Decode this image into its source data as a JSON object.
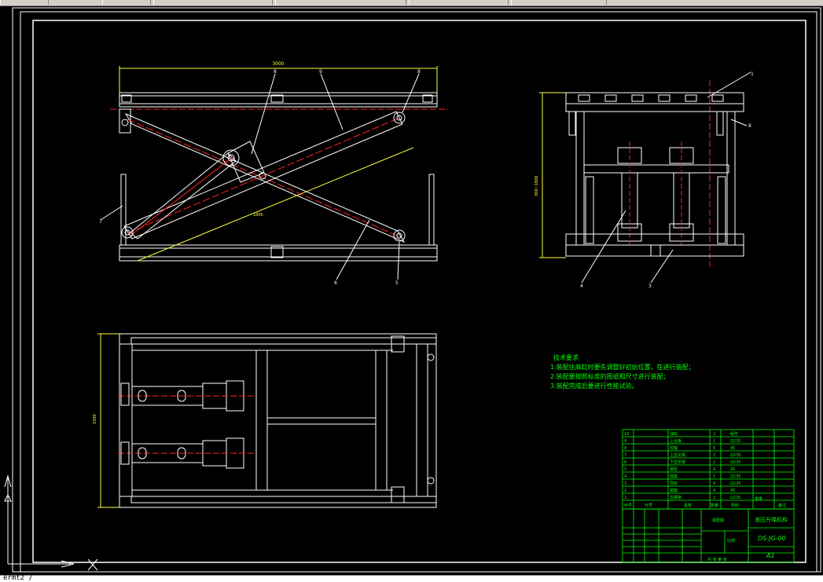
{
  "command_line": {
    "text": "ermt2 /"
  },
  "colors": {
    "background": "#000000",
    "lines": "#ffffff",
    "center": "#ff2020",
    "annotation": "#00ff00",
    "dimension": "#ffff40"
  },
  "front_view": {
    "dimensions": {
      "overall_length": "3000",
      "stroke": "1800"
    },
    "callouts": [
      "8",
      "9",
      "8",
      "7",
      "6",
      "5"
    ]
  },
  "side_view": {
    "dimensions": {
      "height": "300~1800"
    },
    "callouts": [
      "1",
      "8",
      "4",
      "3"
    ]
  },
  "plan_view": {
    "dimensions": {
      "width": "1500"
    }
  },
  "tech_requirements": {
    "title": "技术要求",
    "items": [
      "1.装配往高缸时要先调整好初始位置，在进行装配；",
      "2.装配要按照标准的图纸和尺寸进行装配；",
      "3.装配完成后要进行性能试验。"
    ]
  },
  "bom": {
    "rows": [
      {
        "no": "10",
        "name": "油缸",
        "qty": "2",
        "material": "组件"
      },
      {
        "no": "9",
        "name": "上台板",
        "qty": "1",
        "material": "Q235"
      },
      {
        "no": "8",
        "name": "铰轴",
        "qty": "6",
        "material": "45"
      },
      {
        "no": "7",
        "name": "上剪叉臂",
        "qty": "2",
        "material": "Q235"
      },
      {
        "no": "6",
        "name": "下剪叉臂",
        "qty": "2",
        "material": "Q235"
      },
      {
        "no": "5",
        "name": "滚轮",
        "qty": "4",
        "material": "45"
      },
      {
        "no": "4",
        "name": "底座",
        "qty": "1",
        "material": "Q235"
      },
      {
        "no": "3",
        "name": "导轨",
        "qty": "4",
        "material": "Q235"
      },
      {
        "no": "2",
        "name": "销轴",
        "qty": "4",
        "material": "45"
      },
      {
        "no": "1",
        "name": "支撑架",
        "qty": "2",
        "material": "Q235"
      }
    ],
    "header": {
      "no": "序号",
      "code": "代号",
      "name": "名称",
      "qty": "数量",
      "material": "材料",
      "weight": "重量",
      "note": "备注"
    }
  },
  "title_block": {
    "drawing_title": "液压升降机构",
    "drawing_number": "DS-JG-00",
    "sheet_size": "A1",
    "part_label": "装配图",
    "scale_label": "比例",
    "sheet_label": "共  张  第  张"
  }
}
